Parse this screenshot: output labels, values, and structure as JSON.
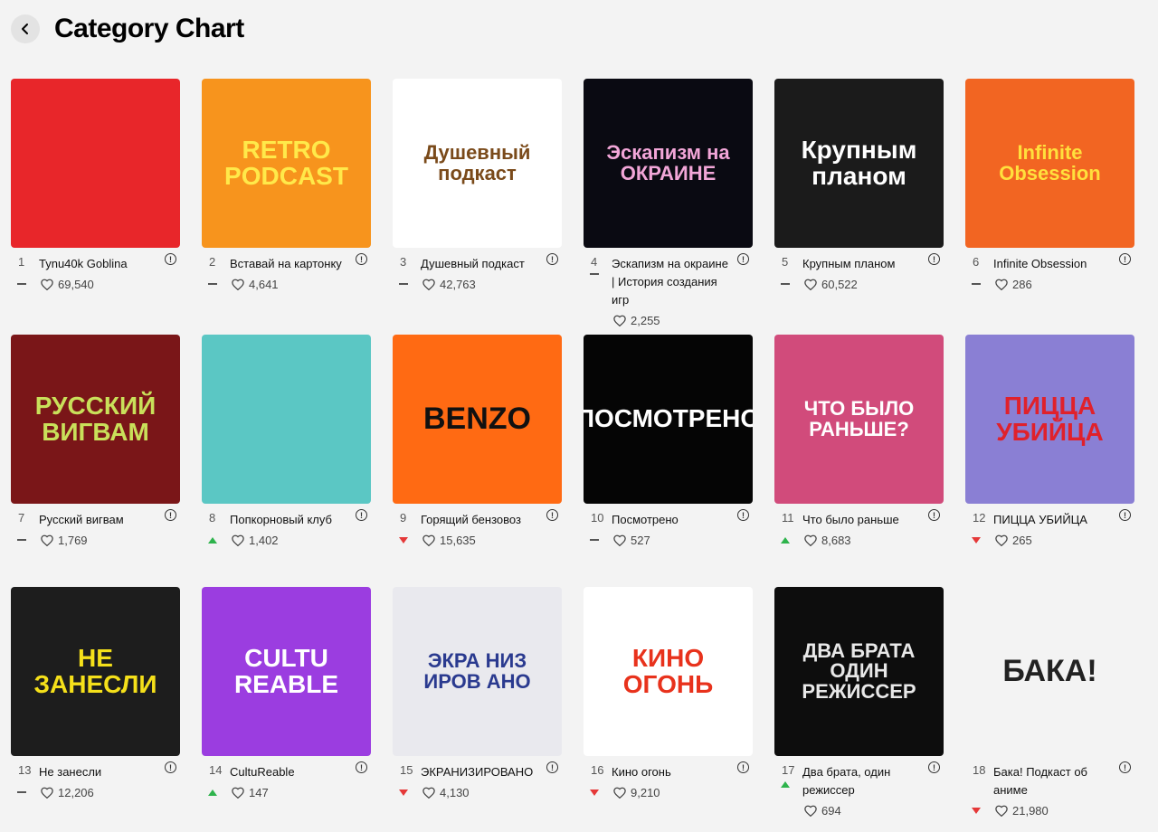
{
  "header": {
    "title": "Category Chart",
    "back_icon": "chevron-left-icon"
  },
  "accents": {
    "up": "#2eb34c",
    "down": "#e53838",
    "neutral": "#555555"
  },
  "podcasts": [
    {
      "rank": "1",
      "title": "Tynu40k Goblina",
      "trend": "same",
      "likes": "69,540",
      "cover_bg": "#e8262a",
      "cover_fg": "#ffffff",
      "cover_text": ""
    },
    {
      "rank": "2",
      "title": "Вставай на картонку",
      "trend": "same",
      "likes": "4,641",
      "cover_bg": "#f7941d",
      "cover_fg": "#ffe94a",
      "cover_text": "RETRO PODCAST"
    },
    {
      "rank": "3",
      "title": "Душевный подкаст",
      "trend": "same",
      "likes": "42,763",
      "cover_bg": "#ffffff",
      "cover_fg": "#7a4a1a",
      "cover_text": "Душевный подкаст"
    },
    {
      "rank": "4",
      "title": "Эскапизм на окраине | История создания игр",
      "trend": "same",
      "likes": "2,255",
      "cover_bg": "#0a0a12",
      "cover_fg": "#f2a6d8",
      "cover_text": "Эскапизм на ОКРАИНЕ"
    },
    {
      "rank": "5",
      "title": "Крупным планом",
      "trend": "same",
      "likes": "60,522",
      "cover_bg": "#1b1b1b",
      "cover_fg": "#ffffff",
      "cover_text": "Крупным планом"
    },
    {
      "rank": "6",
      "title": "Infinite Obsession",
      "trend": "same",
      "likes": "286",
      "cover_bg": "#f26522",
      "cover_fg": "#ffe03d",
      "cover_text": "Infinite Obsession"
    },
    {
      "rank": "7",
      "title": "Русский вигвам",
      "trend": "same",
      "likes": "1,769",
      "cover_bg": "#7a1618",
      "cover_fg": "#c9e05a",
      "cover_text": "РУССКИЙ ВИГВАМ"
    },
    {
      "rank": "8",
      "title": "Попкорновый клуб",
      "trend": "up",
      "likes": "1,402",
      "cover_bg": "#5bc7c4",
      "cover_fg": "#b5161b",
      "cover_text": ""
    },
    {
      "rank": "9",
      "title": "Горящий бензовоз",
      "trend": "down",
      "likes": "15,635",
      "cover_bg": "#ff6a13",
      "cover_fg": "#111111",
      "cover_text": "BENZO"
    },
    {
      "rank": "10",
      "title": "Посмотрено",
      "trend": "same",
      "likes": "527",
      "cover_bg": "#050505",
      "cover_fg": "#ffffff",
      "cover_text": "ПОСМОТРЕНО"
    },
    {
      "rank": "11",
      "title": "Что было раньше",
      "trend": "up",
      "likes": "8,683",
      "cover_bg": "#d14b7b",
      "cover_fg": "#ffffff",
      "cover_text": "ЧТО БЫЛО РАНЬШЕ?"
    },
    {
      "rank": "12",
      "title": "ПИЦЦА УБИЙЦА",
      "trend": "down",
      "likes": "265",
      "cover_bg": "#8a7fd4",
      "cover_fg": "#e0212b",
      "cover_text": "ПИЦЦА УБИЙЦА"
    },
    {
      "rank": "13",
      "title": "Не занесли",
      "trend": "same",
      "likes": "12,206",
      "cover_bg": "#1d1d1d",
      "cover_fg": "#f5e01a",
      "cover_text": "НЕ ЗАНЕСЛИ"
    },
    {
      "rank": "14",
      "title": "CultuReable",
      "trend": "up",
      "likes": "147",
      "cover_bg": "#9b3de0",
      "cover_fg": "#ffffff",
      "cover_text": "CULTU REABLE"
    },
    {
      "rank": "15",
      "title": "ЭКРАНИЗИРОВАНО",
      "trend": "down",
      "likes": "4,130",
      "cover_bg": "#e9e9ee",
      "cover_fg": "#2a3a8f",
      "cover_text": "ЭКРА НИЗ ИРОВ АНО"
    },
    {
      "rank": "16",
      "title": "Кино огонь",
      "trend": "down",
      "likes": "9,210",
      "cover_bg": "#ffffff",
      "cover_fg": "#e8321c",
      "cover_text": "КИНО ОГОНЬ"
    },
    {
      "rank": "17",
      "title": "Два брата, один режиссер",
      "trend": "up",
      "likes": "694",
      "cover_bg": "#0d0d0d",
      "cover_fg": "#e8e8e8",
      "cover_text": "ДВА БРАТА ОДИН РЕЖИССЕР"
    },
    {
      "rank": "18",
      "title": "Бака! Подкаст об аниме",
      "trend": "down",
      "likes": "21,980",
      "cover_bg": "#f3f3f3",
      "cover_fg": "#222222",
      "cover_text": "БАКА!"
    }
  ]
}
